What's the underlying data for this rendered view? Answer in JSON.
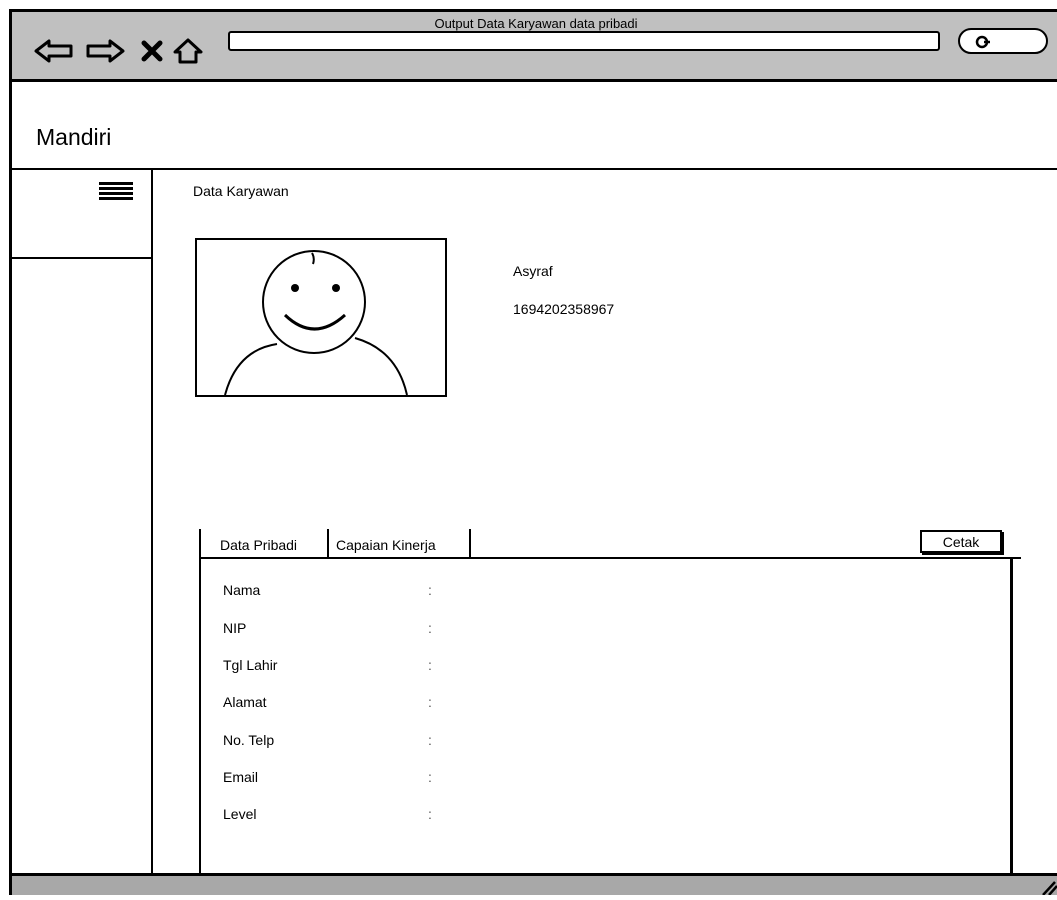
{
  "browser": {
    "title": "Output Data Karyawan data pribadi",
    "icons": [
      "back-arrow-icon",
      "forward-arrow-icon",
      "close-icon",
      "home-icon",
      "search-icon"
    ]
  },
  "header": {
    "brand": "Mandiri"
  },
  "sidebar": {
    "menu_icon": "hamburger-menu-icon"
  },
  "main": {
    "section_title": "Data Karyawan",
    "employee": {
      "name": "Asyraf",
      "id": "1694202358967"
    },
    "tabs": [
      {
        "label": "Data Pribadi"
      },
      {
        "label": "Capaian Kinerja"
      }
    ],
    "print_button": "Cetak",
    "fields": [
      {
        "label": "Nama",
        "separator": ":"
      },
      {
        "label": "NIP",
        "separator": ":"
      },
      {
        "label": "Tgl Lahir",
        "separator": ":"
      },
      {
        "label": "Alamat",
        "separator": ":"
      },
      {
        "label": "No. Telp",
        "separator": ":"
      },
      {
        "label": "Email",
        "separator": ":"
      },
      {
        "label": "Level",
        "separator": ":"
      }
    ]
  }
}
